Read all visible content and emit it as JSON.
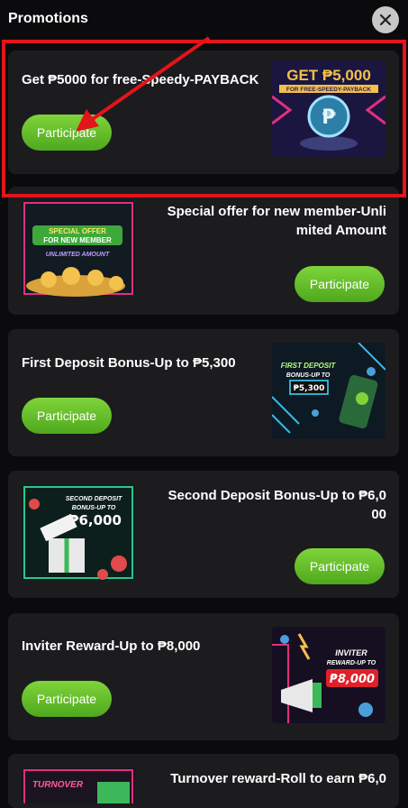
{
  "header": {
    "title": "Promotions"
  },
  "promotions": [
    {
      "title": "Get ₱5000 for free-Speedy-PAYBACK",
      "button": "Participate",
      "image": {
        "big": "GET ₱5,000",
        "small": "FOR FREE-SPEEDY-PAYBACK",
        "icon": "peso-coin"
      }
    },
    {
      "title": "Special offer for new member-Unli mited Amount",
      "button": "Participate",
      "image": {
        "line1": "SPECIAL OFFER",
        "line2": "FOR NEW MEMBER",
        "line3": "UNLIMITED AMOUNT"
      }
    },
    {
      "title": "First Deposit Bonus-Up to ₱5,300",
      "button": "Participate",
      "image": {
        "line1": "FIRST DEPOSIT",
        "line2": "BONUS-UP TO",
        "amount": "₱5,300"
      }
    },
    {
      "title": "Second Deposit Bonus-Up to ₱6,0 00",
      "button": "Participate",
      "image": {
        "line1": "SECOND DEPOSIT",
        "line2": "BONUS-UP TO",
        "amount": "₱6,000"
      }
    },
    {
      "title": "Inviter Reward-Up to ₱8,000",
      "button": "Participate",
      "image": {
        "line1": "INVITER",
        "line2": "REWARD-UP TO",
        "amount": "₱8,000"
      }
    },
    {
      "title": "Turnover reward-Roll to earn ₱6,0",
      "button": "",
      "image": {
        "line1": "TURNOVER"
      }
    }
  ],
  "colors": {
    "accent_green": "#6cc42e",
    "highlight_red": "#e3141a",
    "card_bg": "#1c1c1f"
  }
}
